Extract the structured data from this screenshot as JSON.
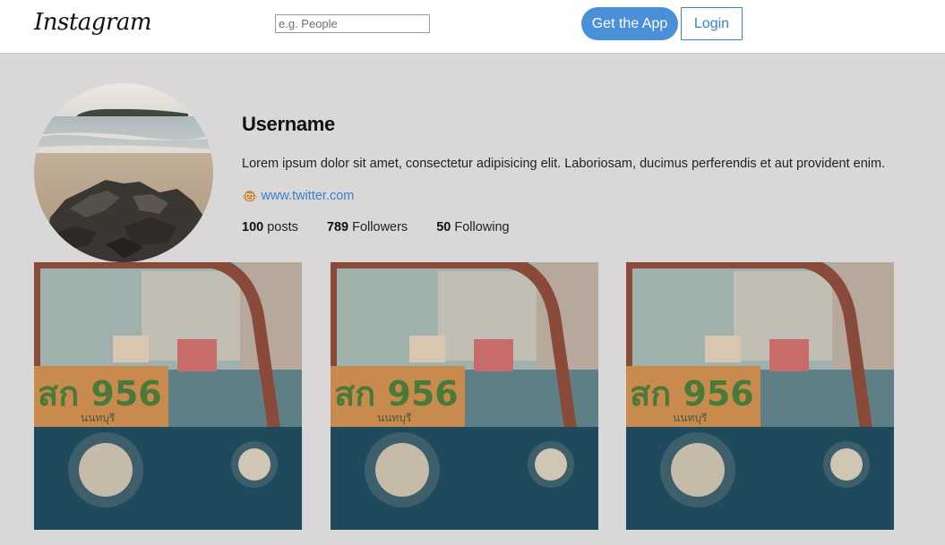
{
  "header": {
    "logo": "Instagram",
    "search": {
      "placeholder": "e.g. People",
      "value": ""
    },
    "get_app_label": "Get the App",
    "login_label": "Login"
  },
  "profile": {
    "username": "Username",
    "bio": "Lorem ipsum dolor sit amet, consectetur adipisicing elit. Laboriosam, ducimus perferendis et aut provident enim.",
    "link_icon": "🐵",
    "link": "www.twitter.com",
    "stats": [
      {
        "count": "100",
        "label": "posts"
      },
      {
        "count": "789",
        "label": "Followers"
      },
      {
        "count": "50",
        "label": "Following"
      }
    ]
  },
  "posts": [
    {
      "plate_text": "สก 956",
      "plate_sub": "นนทบุรี"
    },
    {
      "plate_text": "สก 956",
      "plate_sub": "นนทบุรี"
    },
    {
      "plate_text": "สก 956",
      "plate_sub": "นนทบุรี"
    }
  ],
  "colors": {
    "accent": "#4a90d9",
    "background": "#dad7d8",
    "header": "#ffffff"
  }
}
